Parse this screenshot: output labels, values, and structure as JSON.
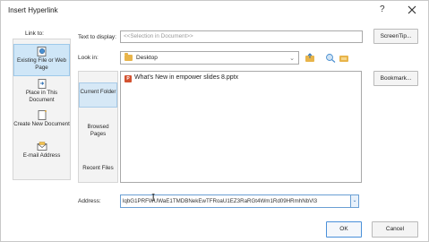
{
  "window": {
    "title": "Insert Hyperlink",
    "help_label": "?"
  },
  "link_to": {
    "label": "Link to:",
    "items": [
      {
        "label": "Existing File or Web Page"
      },
      {
        "label": "Place in This Document"
      },
      {
        "label": "Create New Document"
      },
      {
        "label": "E-mail Address"
      }
    ]
  },
  "text_to_display": {
    "label": "Text to display:",
    "value": "<<Selection in Document>>"
  },
  "screentip_button": "ScreenTip...",
  "look_in": {
    "label": "Look in:",
    "value": "Desktop"
  },
  "bookmark_button": "Bookmark...",
  "nav": [
    {
      "label": "Current Folder"
    },
    {
      "label": "Browsed Pages"
    },
    {
      "label": "Recent Files"
    }
  ],
  "files": [
    {
      "name": "What's New in empower slides 8.pptx",
      "icon": "powerpoint-file-icon"
    }
  ],
  "address": {
    "label": "Address:",
    "value": "lqbG1PRFWUWaE1TMDBNekEwTFRoaU1EZ3RaRGt4Wm1Rd09HRmhNbVl3"
  },
  "ok_button": "OK",
  "cancel_button": "Cancel",
  "colors": {
    "accent": "#4a90d9",
    "selected_bg": "#cfe6f7",
    "folder": "#e8b44a",
    "powerpoint": "#d35230"
  }
}
